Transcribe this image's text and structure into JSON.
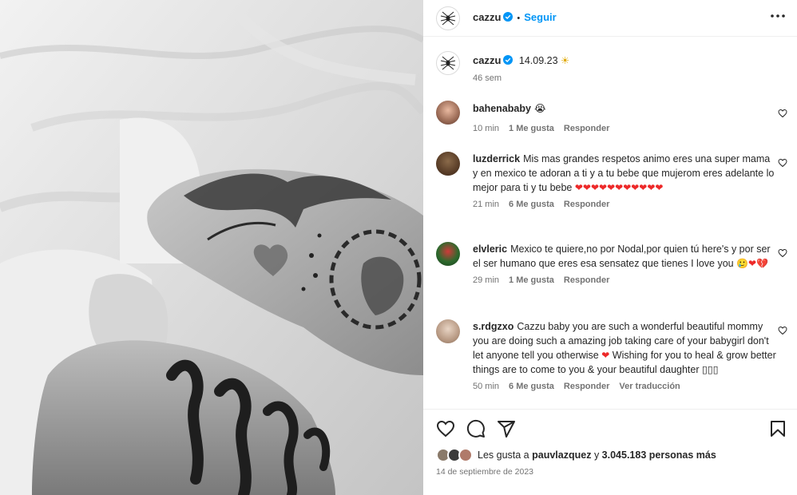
{
  "post": {
    "author": "cazzu",
    "follow_label": "Seguir",
    "separator": "•"
  },
  "caption": {
    "author": "cazzu",
    "text": "14.09.23",
    "emoji": "☀",
    "time_ago": "46 sem"
  },
  "comments": [
    {
      "user": "bahenababy",
      "text": "",
      "emoji": "😭",
      "time": "10 min",
      "likes": "1 Me gusta",
      "reply": "Responder",
      "extra": ""
    },
    {
      "user": "luzderrick",
      "text": "Mis mas grandes respetos animo eres una super mama y en mexico te adoran a ti y a tu bebe que mujerom eres adelante lo mejor para ti y tu bebe",
      "emoji": "❤❤❤❤❤❤❤❤❤❤❤",
      "time": "21 min",
      "likes": "6 Me gusta",
      "reply": "Responder",
      "extra": ""
    },
    {
      "user": "elvleric",
      "text": "Mexico te quiere,no por Nodal,por quien tú here's y por ser el ser humano que eres esa sensatez que tienes I love you",
      "emoji": "🥲❤💔",
      "time": "29 min",
      "likes": "1 Me gusta",
      "reply": "Responder",
      "extra": ""
    },
    {
      "user": "s.rdgzxo",
      "text": "Cazzu baby you are such a wonderful beautiful mommy you are doing such a amazing job taking care of your babygirl don't let anyone tell you otherwise",
      "emoji": "❤",
      "text2": "Wishing for you to heal & grow better things are to come to you & your beautiful daughter ▯▯▯",
      "time": "50 min",
      "likes": "6 Me gusta",
      "reply": "Responder",
      "extra": "Ver traducción"
    }
  ],
  "likes_line": {
    "prefix": "Les gusta a",
    "user": "pauvlazquez",
    "conj": "y",
    "count": "3.045.183 personas más"
  },
  "date": "14 de septiembre de 2023",
  "icons": {
    "more": "more-horizontal-icon",
    "like": "heart-icon",
    "comment": "comment-bubble-icon",
    "share": "paper-plane-icon",
    "save": "bookmark-icon",
    "verified": "verified-badge-icon"
  },
  "colors": {
    "accent": "#0095f6",
    "heart": "#ed2929",
    "verified": "#0095f6"
  }
}
